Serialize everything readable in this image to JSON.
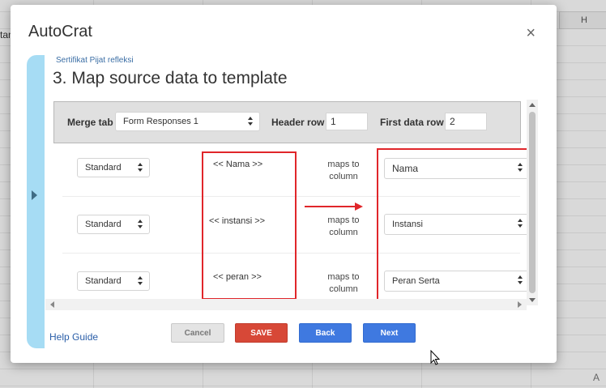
{
  "background": {
    "column_header": "H",
    "cell_fragment": "tan",
    "corner_mark": "A"
  },
  "dialog": {
    "title": "AutoCrat",
    "close_label": "×",
    "breadcrumb": "Sertifikat Pijat refleksi",
    "step_title": "3. Map source data to template"
  },
  "merge_bar": {
    "merge_tab_label": "Merge tab",
    "merge_tab_value": "Form Responses 1",
    "header_row_label": "Header row",
    "header_row_value": "1",
    "first_data_row_label": "First data row",
    "first_data_row_value": "2"
  },
  "mappings": [
    {
      "type": "Standard",
      "tag": "<< Nama >>",
      "maps_to": "maps to\ncolumn",
      "column": "Nama"
    },
    {
      "type": "Standard",
      "tag": "<< instansi >>",
      "maps_to": "maps to\ncolumn",
      "column": "Instansi"
    },
    {
      "type": "Standard",
      "tag": "<< peran >>",
      "maps_to": "maps to\ncolumn",
      "column": "Peran Serta"
    }
  ],
  "footer": {
    "help_label": "Help Guide",
    "cancel_label": "Cancel",
    "save_label": "SAVE",
    "back_label": "Back",
    "next_label": "Next"
  },
  "colors": {
    "annotation_red": "#e0262a",
    "primary_blue": "#3f79e0",
    "save_red": "#d74837",
    "rail_blue": "#a6dcf4"
  },
  "icons": [
    "close-icon",
    "expand-arrow-icon",
    "select-arrows-icon",
    "red-arrow-annotation",
    "mouse-cursor-icon"
  ]
}
